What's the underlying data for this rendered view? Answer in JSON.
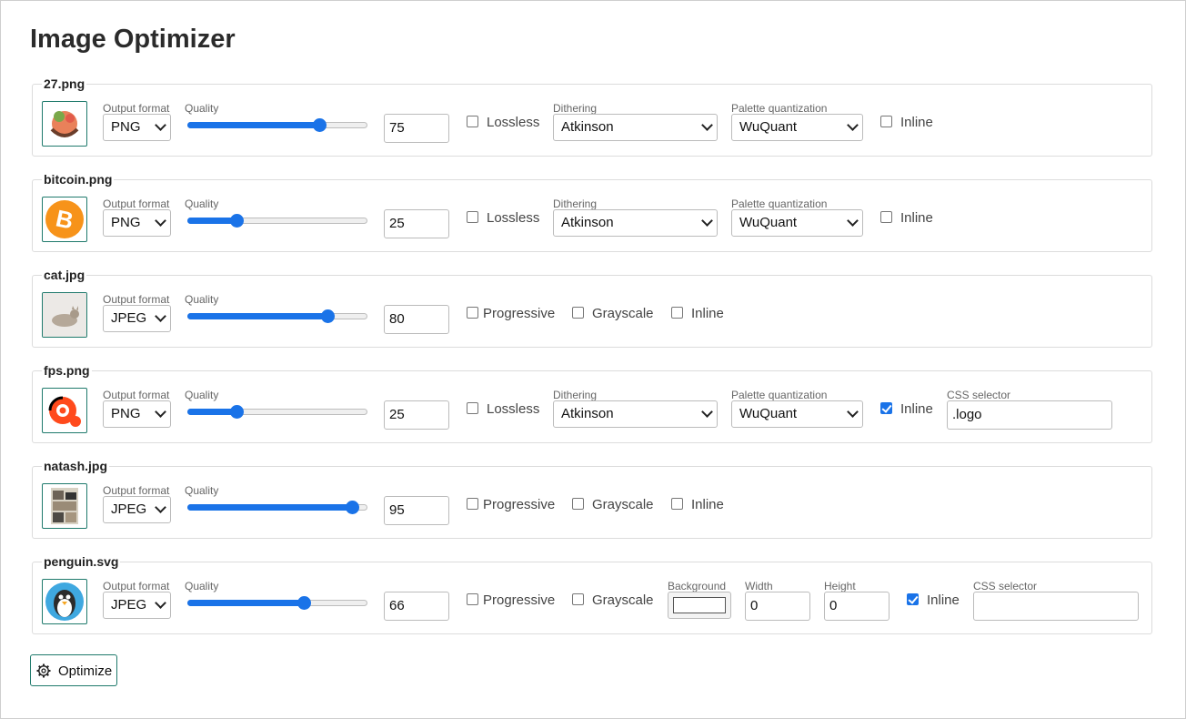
{
  "page_title": "Image Optimizer",
  "labels": {
    "output_format": "Output format",
    "quality": "Quality",
    "dithering": "Dithering",
    "palette": "Palette quantization",
    "css_selector": "CSS selector",
    "background": "Background",
    "width": "Width",
    "height": "Height",
    "lossless": "Lossless",
    "inline": "Inline",
    "progressive": "Progressive",
    "grayscale": "Grayscale"
  },
  "rows": [
    {
      "file": "27.png",
      "format": "PNG",
      "quality": 75,
      "quality_display": "75",
      "dithering": "Atkinson",
      "palette": "WuQuant",
      "lossless": false,
      "inline": false
    },
    {
      "file": "bitcoin.png",
      "format": "PNG",
      "quality": 25,
      "quality_display": "25",
      "dithering": "Atkinson",
      "palette": "WuQuant",
      "lossless": false,
      "inline": false
    },
    {
      "file": "cat.jpg",
      "format": "JPEG",
      "quality": 80,
      "quality_display": "80",
      "progressive": false,
      "grayscale": false,
      "inline": false
    },
    {
      "file": "fps.png",
      "format": "PNG",
      "quality": 25,
      "quality_display": "25",
      "dithering": "Atkinson",
      "palette": "WuQuant",
      "lossless": false,
      "inline": true,
      "css_selector": ".logo"
    },
    {
      "file": "natash.jpg",
      "format": "JPEG",
      "quality": 95,
      "quality_display": "95",
      "progressive": false,
      "grayscale": false,
      "inline": false
    },
    {
      "file": "penguin.svg",
      "format": "JPEG",
      "quality": 66,
      "quality_display": "66",
      "progressive": false,
      "grayscale": false,
      "background": "#ffffff",
      "width": "0",
      "height": "0",
      "inline": true,
      "css_selector": ""
    }
  ],
  "optimize_button": "Optimize",
  "icons": [
    "sloth-image-icon",
    "bitcoin-image-icon",
    "cat-photo-icon",
    "fps-logo-icon",
    "photo-collage-icon",
    "penguin-image-icon",
    "gear-icon"
  ],
  "colors": {
    "accent": "#1a73e8",
    "thumb_border": "#1f7a6c",
    "bitcoin": "#f7931a",
    "fps": "#ff4a1c",
    "penguin": "#3fa8e0"
  }
}
